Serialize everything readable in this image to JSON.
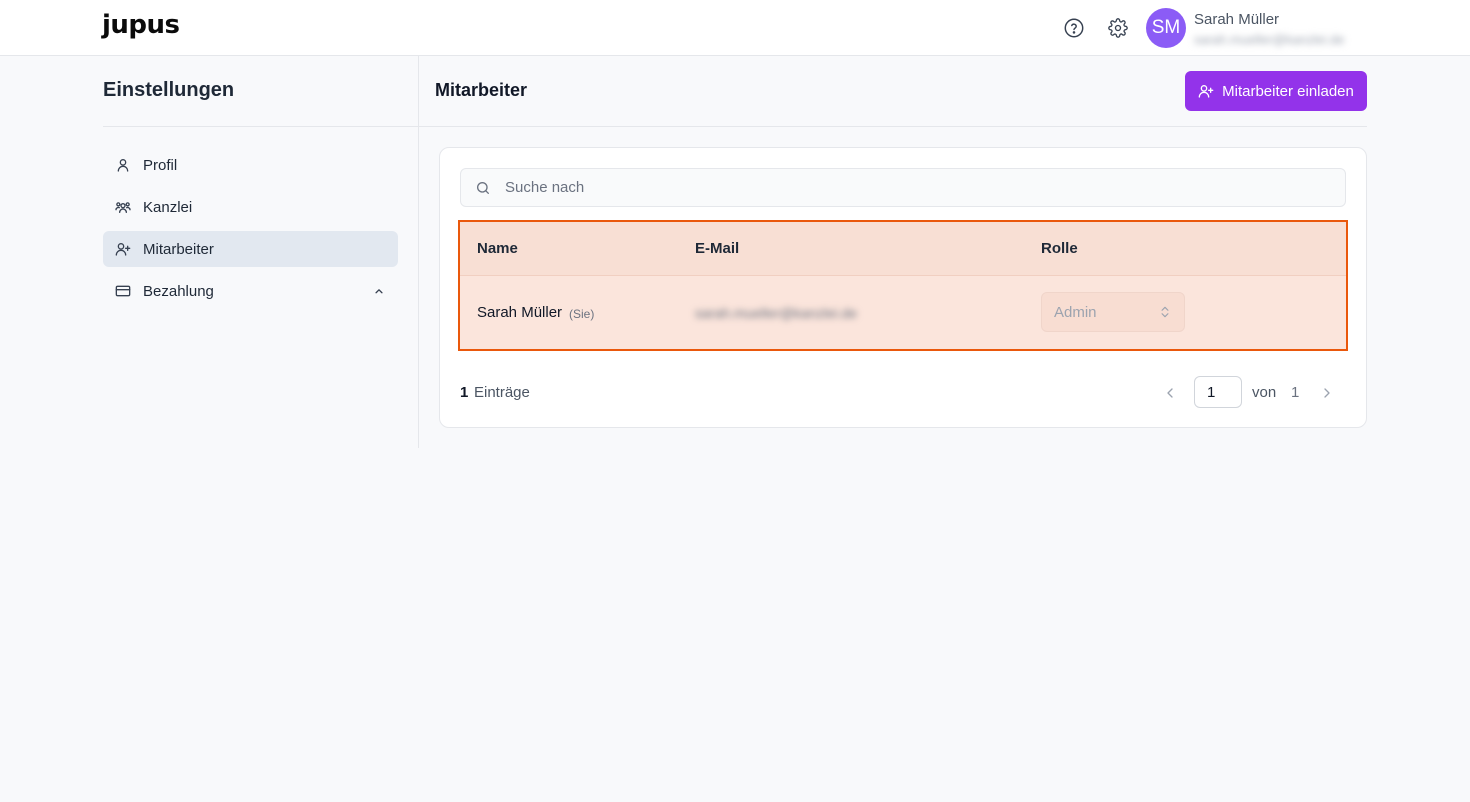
{
  "app": {
    "logo": "jupus"
  },
  "topbar": {
    "help_icon": "help-circle-icon",
    "settings_icon": "gear-icon",
    "avatar_initials": "SM",
    "user_name": "Sarah Müller",
    "user_email": "sarah.mueller@kanzlei.de"
  },
  "sidebar": {
    "title": "Einstellungen",
    "items": [
      {
        "label": "Profil",
        "icon": "user-icon",
        "active": false
      },
      {
        "label": "Kanzlei",
        "icon": "users-group-icon",
        "active": false
      },
      {
        "label": "Mitarbeiter",
        "icon": "user-plus-icon",
        "active": true
      },
      {
        "label": "Bezahlung",
        "icon": "credit-card-icon",
        "active": false,
        "expand_icon": "chevron-up-icon"
      }
    ]
  },
  "main": {
    "title": "Mitarbeiter",
    "invite_button": "Mitarbeiter einladen",
    "search_placeholder": "Suche nach",
    "table": {
      "headers": [
        "Name",
        "E-Mail",
        "Rolle"
      ],
      "rows": [
        {
          "name": "Sarah Müller",
          "tag": "(Sie)",
          "email": "sarah.mueller@kanzlei.de",
          "role": "Admin"
        }
      ]
    },
    "pagination": {
      "count": "1",
      "count_label": "Einträge",
      "page": "1",
      "of_label": "von",
      "total_pages": "1"
    }
  },
  "colors": {
    "accent": "#9333ea",
    "avatar": "#8b5cf6",
    "highlight_border": "#ea580c",
    "highlight_fill": "#fce4da"
  }
}
